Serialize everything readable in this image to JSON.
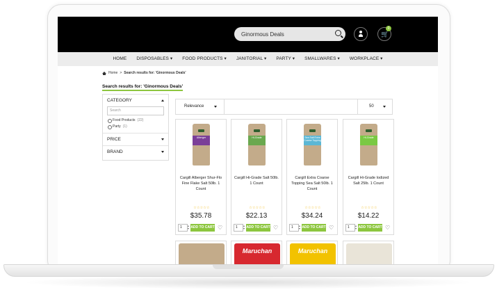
{
  "header": {
    "search_value": "Ginormous Deals",
    "cart_count": "0"
  },
  "nav": {
    "items": [
      "HOME",
      "DISPOSABLES ▾",
      "FOOD PRODUCTS ▾",
      "JANITORIAL ▾",
      "PARTY ▾",
      "SMALLWARES ▾",
      "WORKPLACE ▾"
    ]
  },
  "breadcrumb": {
    "home": "Home",
    "separator": ">",
    "current": "Search results for: 'Ginormous Deals'"
  },
  "results_title": "Search results for: 'Ginormous Deals'",
  "sidebar": {
    "category_label": "CATEGORY",
    "search_placeholder": "Search",
    "options": [
      {
        "label": "Food Products",
        "count": "(22)"
      },
      {
        "label": "Party",
        "count": "(1)"
      }
    ],
    "price_label": "PRICE",
    "brand_label": "BRAND"
  },
  "toolbar": {
    "sort_value": "Relevance",
    "per_page_value": "50"
  },
  "products": [
    {
      "name": "Cargill Alberger Shur-Flo Fine Flake Salt 50lb. 1 Count",
      "bag_text": "Alberger",
      "band_color": "#7b3f98",
      "price": "$35.78",
      "qty": "1",
      "add_label": "ADD TO CART",
      "stars": "☆☆☆☆☆"
    },
    {
      "name": "Cargill Hi-Grade Salt 50lb. 1 Count",
      "bag_text": "Hi-Grade",
      "band_color": "#6aa84f",
      "price": "$22.13",
      "qty": "1",
      "add_label": "ADD TO CART",
      "stars": "☆☆☆☆☆"
    },
    {
      "name": "Cargill Extra Coarse Topping Sea Salt 50lb. 1 Count",
      "bag_text": "Sea Salt Extra Coarse Topping",
      "band_color": "#5bb7d5",
      "price": "$34.24",
      "qty": "1",
      "add_label": "ADD TO CART",
      "stars": "☆☆☆☆☆"
    },
    {
      "name": "Cargill Hi-Grade Iodized Salt 25lb. 1 Count",
      "bag_text": "Hi-Grade",
      "band_color": "#7ac943",
      "price": "$14.22",
      "qty": "1",
      "add_label": "ADD TO CART",
      "stars": "☆☆☆☆☆"
    }
  ],
  "second_row": [
    {
      "label": "",
      "color": "#c3ab8a"
    },
    {
      "label": "Maruchan",
      "color": "#d7282f"
    },
    {
      "label": "Maruchan",
      "color": "#f2c200"
    },
    {
      "label": "",
      "color": "#e9e4d8"
    }
  ],
  "icons": {
    "search": "search-icon",
    "user": "user-icon",
    "cart": "cart-icon",
    "home": "home-icon",
    "wishlist": "heart-icon"
  },
  "colors": {
    "accent": "#8dc63f",
    "header_bg": "#000000",
    "nav_bg": "#ececec"
  }
}
